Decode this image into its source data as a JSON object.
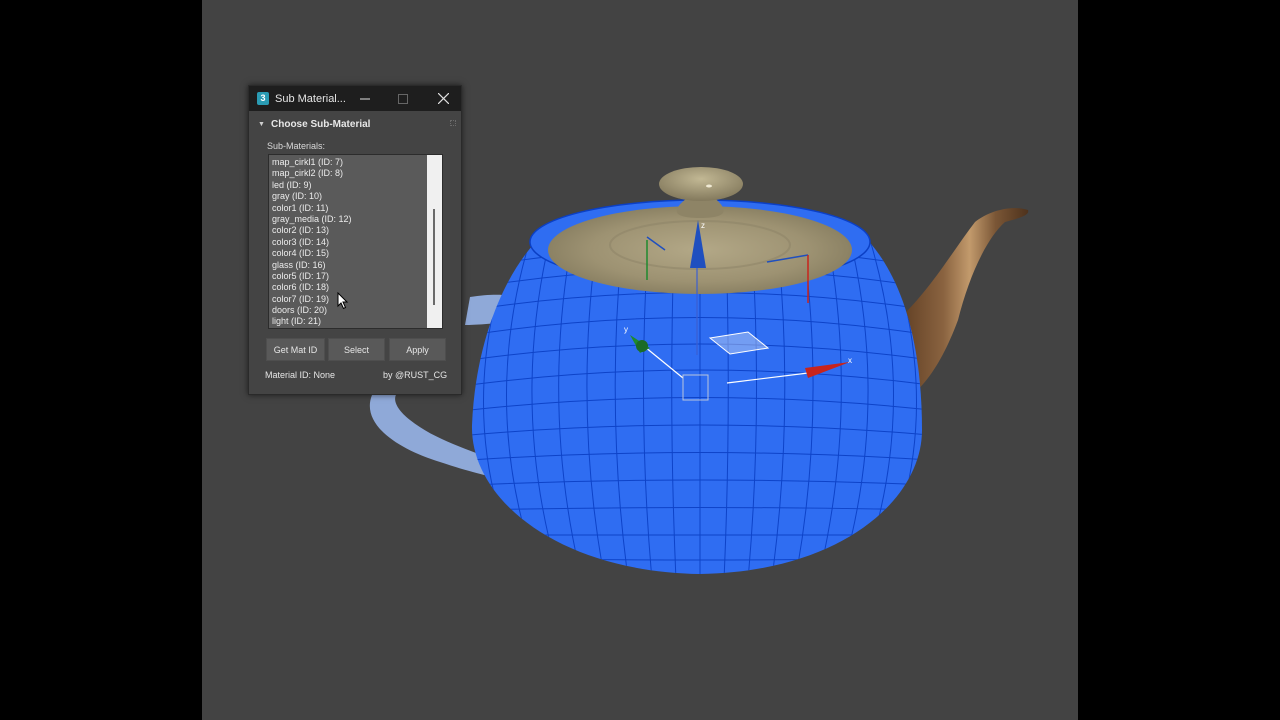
{
  "window": {
    "title": "Sub Material...",
    "app_icon_text": "3"
  },
  "rollout": {
    "title": "Choose Sub-Material"
  },
  "submaterials": {
    "label": "Sub-Materials:",
    "items": [
      "map_cirkl1 (ID: 7)",
      "map_cirkl2 (ID: 8)",
      "led (ID: 9)",
      "gray (ID: 10)",
      "color1 (ID: 11)",
      "gray_media (ID: 12)",
      "color2 (ID: 13)",
      "color3 (ID: 14)",
      "color4 (ID: 15)",
      "glass (ID: 16)",
      "color5 (ID: 17)",
      "color6 (ID: 18)",
      "color7 (ID: 19)",
      "doors (ID: 20)",
      "light (ID: 21)"
    ]
  },
  "buttons": {
    "get_mat_id": "Get Mat ID",
    "select": "Select",
    "apply": "Apply"
  },
  "status": {
    "material_id": "Material ID: None",
    "credit": "by @RUST_CG"
  },
  "viewport": {
    "gizmo_x_label": "x",
    "gizmo_y_label": "y",
    "gizmo_z_label": "z",
    "colors": {
      "background": "#434343",
      "selection_blue": "#2f6df2",
      "wire_blue": "#0b3fc4",
      "handle": "#8fa9d8",
      "wood": "#7a5636",
      "lid": "#a39878",
      "gizmo_x": "#c8241c",
      "gizmo_y": "#1f8a2e",
      "gizmo_z": "#1f4fbf"
    }
  }
}
